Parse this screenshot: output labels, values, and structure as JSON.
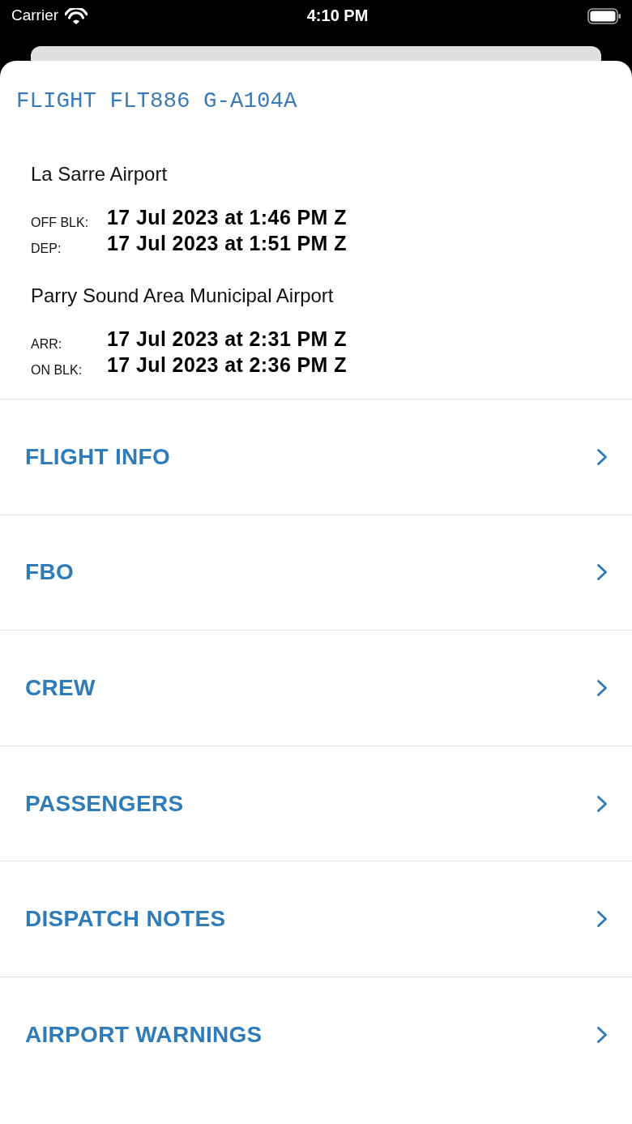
{
  "status_bar": {
    "carrier": "Carrier",
    "time": "4:10 PM"
  },
  "title": "FLIGHT FLT886 G-A104A",
  "legs": [
    {
      "airport": "La Sarre Airport",
      "times": [
        {
          "label": "OFF BLK:",
          "value": "17 Jul 2023 at 1:46 PM Z"
        },
        {
          "label": "DEP:",
          "value": "17 Jul 2023 at 1:51 PM Z"
        }
      ]
    },
    {
      "airport": "Parry Sound Area Municipal Airport",
      "times": [
        {
          "label": "ARR:",
          "value": "17 Jul 2023 at 2:31 PM Z"
        },
        {
          "label": "ON BLK:",
          "value": "17 Jul 2023 at 2:36 PM Z"
        }
      ]
    }
  ],
  "sections": [
    {
      "label": "FLIGHT INFO"
    },
    {
      "label": "FBO"
    },
    {
      "label": "CREW"
    },
    {
      "label": "PASSENGERS"
    },
    {
      "label": "DISPATCH NOTES"
    },
    {
      "label": "AIRPORT WARNINGS"
    }
  ]
}
